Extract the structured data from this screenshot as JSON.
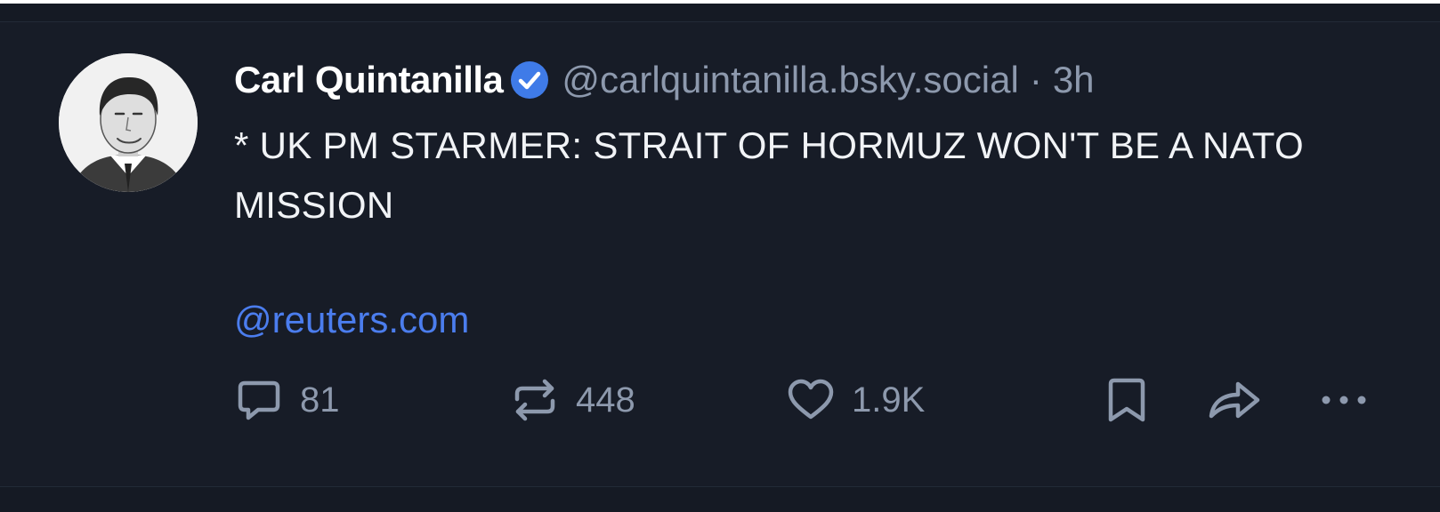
{
  "post": {
    "author_name": "Carl Quintanilla",
    "handle": "@carlquintanilla.bsky.social",
    "separator": "·",
    "time": "3h",
    "text": "* UK PM STARMER: STRAIT OF HORMUZ WON'T BE A NATO MISSION",
    "link": "@reuters.com"
  },
  "actions": {
    "reply_count": "81",
    "repost_count": "448",
    "like_count": "1.9K"
  },
  "icons": {
    "verified": "verified-check-icon",
    "reply": "comment-icon",
    "repost": "repost-icon",
    "like": "heart-icon",
    "bookmark": "bookmark-icon",
    "share": "share-arrow-icon",
    "more": "more-ellipsis-icon"
  },
  "colors": {
    "background": "#171c27",
    "name": "#ffffff",
    "muted": "#8d99ad",
    "link": "#4b7dee",
    "verified": "#3f7be8"
  }
}
